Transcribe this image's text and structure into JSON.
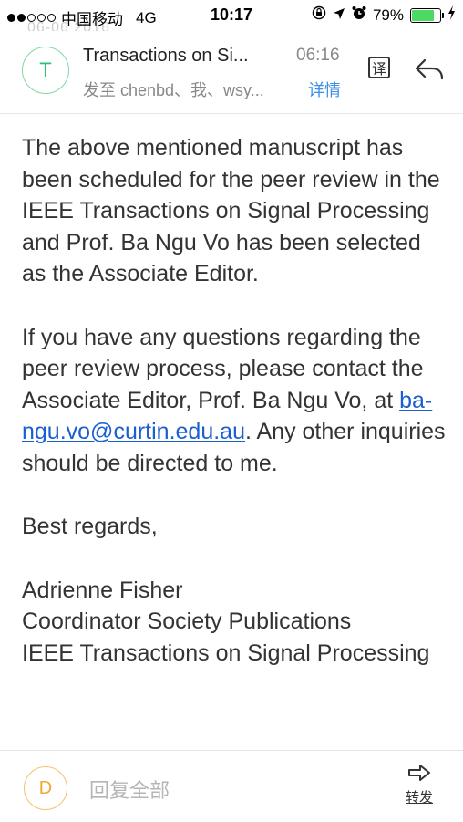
{
  "status_bar": {
    "carrier": "中国移动",
    "network": "4G",
    "time": "10:17",
    "battery_percent": "79%",
    "battery_level": 0.79,
    "faded_date": "06-06 2016"
  },
  "header": {
    "avatar_letter": "T",
    "subject": "Transactions on Si...",
    "time": "06:16",
    "recipients": "发至 chenbd、我、wsy...",
    "details_link": "详情",
    "translate_label": "译"
  },
  "body": {
    "paragraph1": "The above mentioned manuscript has been scheduled for the peer review in the IEEE Transactions on Signal Processing and Prof. Ba Ngu Vo has been selected as the Associate Editor.",
    "paragraph2_before": "If you have any questions regarding the peer review process, please contact the Associate Editor,  Prof. Ba Ngu Vo, at ",
    "email_link": "ba-ngu.vo@curtin.edu.au",
    "paragraph2_after": ". Any other inquiries should be directed to me.",
    "closing": "Best regards,",
    "sig_name": "Adrienne Fisher",
    "sig_title": "Coordinator Society Publications",
    "sig_org": "IEEE Transactions on Signal Processing"
  },
  "bottom_bar": {
    "avatar_letter": "D",
    "reply_all_placeholder": "回复全部",
    "forward_label": "转发"
  },
  "colors": {
    "avatar_t": "#2cc07a",
    "avatar_d": "#f0a830",
    "link": "#1a5fd0",
    "details": "#3a8ee6",
    "battery": "#4cd964"
  }
}
